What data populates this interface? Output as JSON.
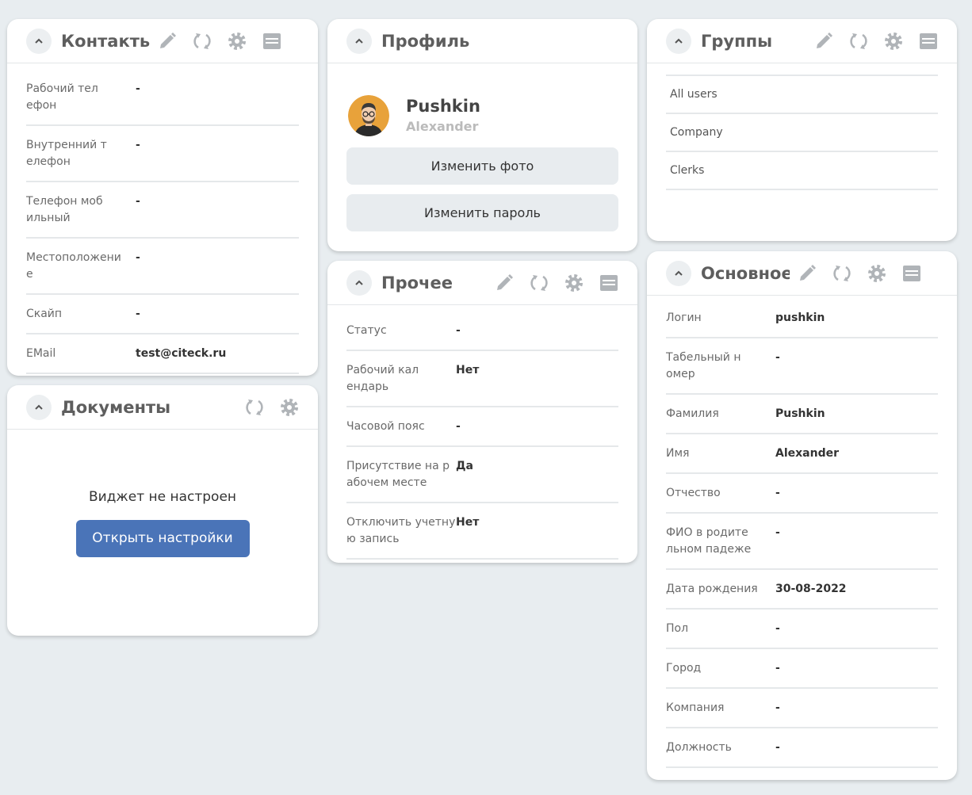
{
  "contacts": {
    "title": "Контакты",
    "rows": [
      {
        "label": "Рабочий телефон",
        "value": "-"
      },
      {
        "label": "Внутренний телефон",
        "value": "-"
      },
      {
        "label": "Телефон мобильный",
        "value": "-"
      },
      {
        "label": "Местоположение",
        "value": "-"
      },
      {
        "label": "Скайп",
        "value": "-"
      },
      {
        "label": "EMail",
        "value": "test@citeck.ru"
      }
    ]
  },
  "documents": {
    "title": "Документы",
    "message": "Виджет не настроен",
    "open_settings": "Открыть настройки"
  },
  "profile": {
    "title": "Профиль",
    "last_name": "Pushkin",
    "first_name": "Alexander",
    "change_photo": "Изменить фото",
    "change_password": "Изменить пароль"
  },
  "other": {
    "title": "Прочее",
    "rows": [
      {
        "label": "Статус",
        "value": "-"
      },
      {
        "label": "Рабочий календарь",
        "value": "Нет"
      },
      {
        "label": "Часовой пояс",
        "value": "-"
      },
      {
        "label": "Присутствие на рабочем месте",
        "value": "Да"
      },
      {
        "label": "Отключить учетную запись",
        "value": "Нет"
      }
    ]
  },
  "groups": {
    "title": "Группы",
    "items": [
      "All users",
      "Company",
      "Clerks"
    ]
  },
  "main": {
    "title": "Основное",
    "rows": [
      {
        "label": "Логин",
        "value": "pushkin"
      },
      {
        "label": "Табельный номер",
        "value": "-"
      },
      {
        "label": "Фамилия",
        "value": "Pushkin"
      },
      {
        "label": "Имя",
        "value": "Alexander"
      },
      {
        "label": "Отчество",
        "value": "-"
      },
      {
        "label": "ФИО в родительном падеже",
        "value": "-"
      },
      {
        "label": "Дата рождения",
        "value": "30-08-2022"
      },
      {
        "label": "Пол",
        "value": "-"
      },
      {
        "label": "Город",
        "value": "-"
      },
      {
        "label": "Компания",
        "value": "-"
      },
      {
        "label": "Должность",
        "value": "-"
      }
    ]
  },
  "colors": {
    "background": "#e8edf0",
    "accent_button": "#4a74b8",
    "icon_gray": "#b0b4b8"
  }
}
